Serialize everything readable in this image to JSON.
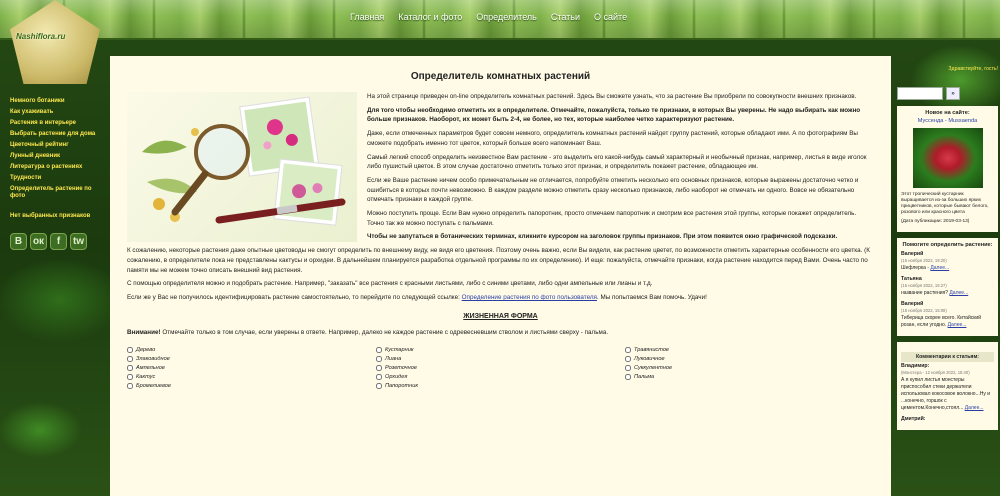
{
  "nav": [
    "Главная",
    "Каталог и фото",
    "Определитель",
    "Статьи",
    "О сайте"
  ],
  "logo": "Nashiflora.ru",
  "sidebar": {
    "items": [
      "Немного ботаники",
      "Как ухаживать",
      "Растения в интерьере",
      "Выбрать растение для дома",
      "Цветочный рейтинг",
      "Лунный дневник",
      "Литература о растениях",
      "Трудности",
      "Определитель растение по фото"
    ],
    "no_favorites": "Нет выбранных признаков",
    "social": [
      "В",
      "ок",
      "f",
      "tw"
    ]
  },
  "main": {
    "title": "Определитель комнатных растений",
    "p1": "На этой странице приведен on-line определитель комнатных растений. Здесь Вы сможете узнать, что за растение Вы приобрели по совокупности внешних признаков.",
    "p2": "Для того чтобы необходимо отметить их в определителе. Отмечайте, пожалуйста, только те признаки, в которых Вы уверены. Не надо выбирать как можно больше признаков. Наоборот, их может быть 2-4, не более, но тех, которые наиболее четко характеризуют растение.",
    "p3": "Даже, если отмеченных параметров будет совсем немного, определитель комнатных растений найдет группу растений, которые обладают ими. А по фотографиям Вы сможете подобрать именно тот цветок, который больше всего напоминает Ваш.",
    "p4": "Самый легкий способ определить неизвестное Вам растение - это выделить его какой-нибудь самый характерный и необычный признак, например, листья в виде иголок либо пушистый цветок. В этом случае достаточно отметить только этот признак, и определитель покажет растение, обладающее им.",
    "p5": "Если же Ваше растение ничем особо примечательным не отличается, попробуйте отметить несколько его основных признаков, которые выражены достаточно четко и ошибиться в которых почти невозможно. В каждом разделе можно отметить сразу несколько признаков, либо наоборот не отмечать ни одного. Вовсе не обязательно отмечать признаки в каждой группе.",
    "p6": "Можно поступить проще. Если Вам нужно определить папоротник, просто отмечаем папоротник и смотрим все растения этой группы, которые покажет определитель. Точно так же можно поступать с пальмами.",
    "p7": "Чтобы не запутаться в ботанических терминах, кликните курсором на заголовок группы признаков. При этом появится окно графической подсказки.",
    "p8": "К сожалению, некоторые растения даже опытные цветоводы не смогут определить по внешнему виду, не видя его цветения. Поэтому очень важно, если Вы видели, как растение цветет, по возможности отметить характерные особенности его цветка. (К сожалению, в определителе пока не представлены кактусы и орхидеи. В дальнейшем планируется разработка отдельной программы по их определению). И еще: пожалуйста, отмечайте признаки, когда растение находится перед Вами. Очень часто по памяти мы не можем точно описать внешний вид растения.",
    "p9": "С помощью определителя можно и подобрать растение. Например, \"заказать\" все растения с красными листьями, либо с синими цветами, либо одни ампельные или лианы и т.д.",
    "p10a": "Если же у Вас не получилось идентифицировать растение самостоятельно, то перейдите по следующей ссылке: ",
    "p10link": "Определение растения по фото пользователя",
    "p10b": ". Мы попытаемся Вам помочь. Удачи!",
    "section": "ЖИЗНЕННАЯ ФОРМА",
    "warn_label": "Внимание!",
    "warn": " Отмечайте только в том случае, если уверены в ответе. Например, далеко не каждое растение с одревесневшим стволом и листьями сверху - пальма.",
    "checks": [
      [
        "Дерево",
        "Злаковидное",
        "Ампельное",
        "Кактус",
        "Бромелиевое"
      ],
      [
        "Кустарник",
        "Лиана",
        "Розеточное",
        "Орхидея",
        "Папоротник"
      ],
      [
        "Травянистое",
        "Луковичное",
        "Суккулентное",
        "Пальма"
      ]
    ]
  },
  "right": {
    "greeting": "Здравствуйте, гость!",
    "search_btn": "»",
    "new_title": "Новое на сайте:",
    "new_item": "Муссенда - Mussaenda",
    "new_text": "Этот тропический кустарник выращивается из-за больших ярких прицветников, которые бывают белого, розового или красного цвета",
    "new_date": "(Дата публикации: 2019-03-13)",
    "help_title": "Помогите определить растение:",
    "comments": [
      {
        "name": "Валерий",
        "date": "(15 ноября 2022, 19:20)",
        "text": "Шефлерка - ",
        "link": "Далее..."
      },
      {
        "name": "Татьяна",
        "date": "(15 ноября 2022, 15:27)",
        "text": "название растения? ",
        "link": "Далее..."
      },
      {
        "name": "Валерий",
        "date": "(15 ноября 2022, 15:08)",
        "text": "Тиберица скорее всего. Китайский розан, если угодно. ",
        "link": "Далее..."
      }
    ],
    "comments_title": "Комментарии к статьям:",
    "c2": [
      {
        "name": "Владимир:",
        "date": "(Монстера - 12 ноября 2022, 15:40)",
        "text": "А я купил листья монстеры приспособил стеки держатели использовал кокосовое волокно...Ну и ...конечно, горшок с цементом.Конечно,стоял... ",
        "link": "Далее..."
      },
      {
        "name": "Дмитрий:",
        "date": "",
        "text": "",
        "link": ""
      }
    ]
  },
  "colors": {
    "accent_yellow": "#ffe84d",
    "main_bg": "#fffbe6",
    "link": "#2a3ea8"
  }
}
